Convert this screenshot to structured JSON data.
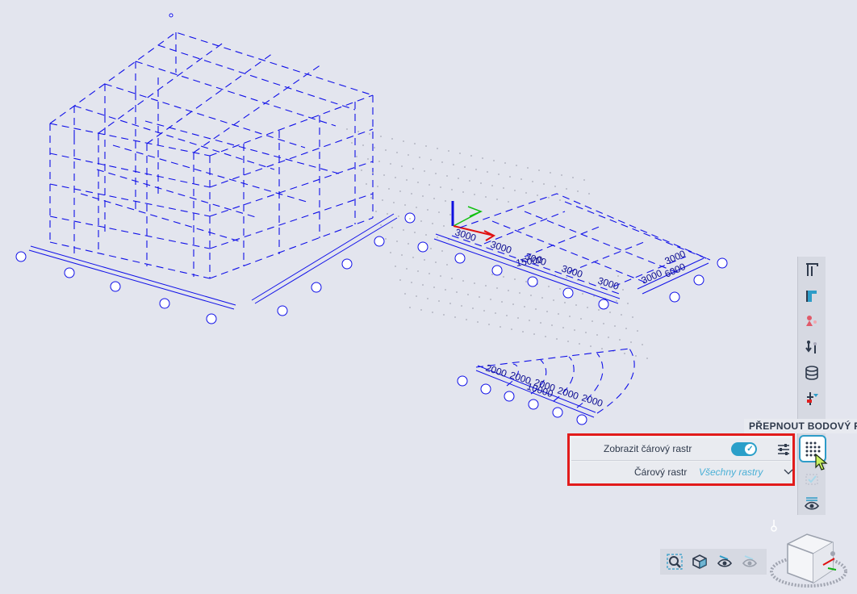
{
  "tooltip": {
    "text": "PŘEPNOUT BODOVÝ RA"
  },
  "panel": {
    "show_line_grid_label": "Zobrazit čárový rastr",
    "show_line_grid_on": true,
    "line_grid_label": "Čárový rastr",
    "line_grid_value": "Všechny rastry"
  },
  "grid_right": {
    "dims_x": [
      "3000",
      "3000",
      "3000",
      "3000",
      "3000"
    ],
    "total_x": "15000",
    "dims_y": [
      "3000",
      "3000"
    ],
    "total_y": "6000"
  },
  "grid_radial": {
    "dims": [
      "2000",
      "2000",
      "2000",
      "2000",
      "2000"
    ],
    "total": "10000"
  },
  "colors": {
    "grid_lines": "#1010e8",
    "accent": "#2d9cc8",
    "highlight_border": "#e21b1b",
    "axis_x": "#e01010",
    "axis_y": "#10c010",
    "axis_z": "#1010e0"
  },
  "toolbar_icons": [
    "beam-icon",
    "column-icon",
    "load-icon",
    "support-icon",
    "layers-icon",
    "result-icon",
    "point-grid-icon",
    "checkbox-icon",
    "view-icon"
  ],
  "bottom_icons": [
    "zoom-all-icon",
    "view-3d-icon",
    "visibility-icon",
    "hidden-icon"
  ]
}
